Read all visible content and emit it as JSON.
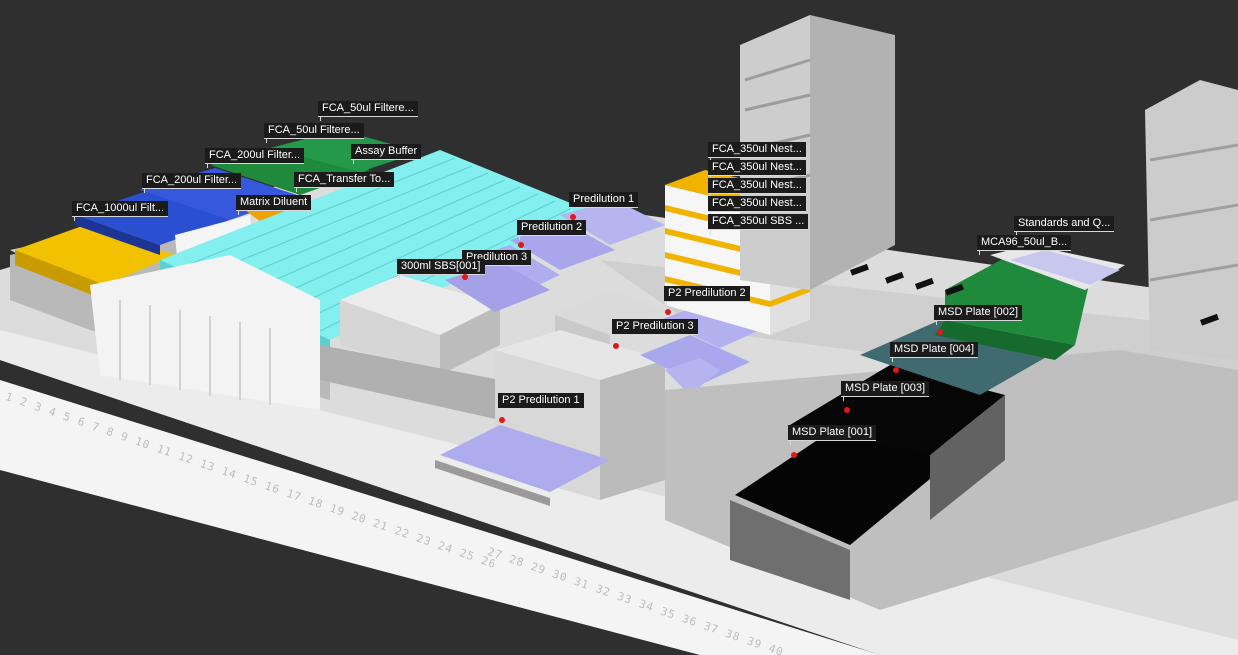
{
  "colors": {
    "background": "#2f2f2f",
    "deck": "#e3e3e3",
    "tip_yellow": "#f2c200",
    "tip_blue": "#2a4fd0",
    "tip_green": "#1f8a3c",
    "tubes_cyan": "#83efef",
    "msd_plate": "#050505",
    "marker": "#e01818",
    "label_bg": "#1b1b1b"
  },
  "labware": [
    {
      "label": "FCA_50ul Filtere..."
    },
    {
      "label": "FCA_50ul Filtere..."
    },
    {
      "label": "Assay Buffer"
    },
    {
      "label": "FCA_200ul Filter..."
    },
    {
      "label": "FCA_200ul Filter..."
    },
    {
      "label": "FCA_Transfer To..."
    },
    {
      "label": "Matrix Diluent"
    },
    {
      "label": "FCA_1000ul Filt..."
    },
    {
      "label": "Predilution 1"
    },
    {
      "label": "Predilution 2"
    },
    {
      "label": "Predilution 3"
    },
    {
      "label": "300ml SBS[001]"
    },
    {
      "label": "FCA_350ul Nest..."
    },
    {
      "label": "FCA_350ul Nest..."
    },
    {
      "label": "FCA_350ul Nest..."
    },
    {
      "label": "FCA_350ul Nest..."
    },
    {
      "label": "FCA_350ul SBS ..."
    },
    {
      "label": "P2 Predilution 2"
    },
    {
      "label": "P2 Predilution 3"
    },
    {
      "label": "P2 Predilution 1"
    },
    {
      "label": "Standards and Q..."
    },
    {
      "label": "MCA96_50ul_B..."
    },
    {
      "label": "MSD Plate [002]"
    },
    {
      "label": "MSD Plate [004]"
    },
    {
      "label": "MSD Plate [003]"
    },
    {
      "label": "MSD Plate [001]"
    }
  ],
  "ruler": {
    "left": "1 2 3 4 5 6 7 8 9 10 11 12 13 14 15 16 17 18 19 20 21 22 23 24 25 26",
    "right": "27 28 29 30 31 32 33 34 35 36 37 38 39 40"
  }
}
